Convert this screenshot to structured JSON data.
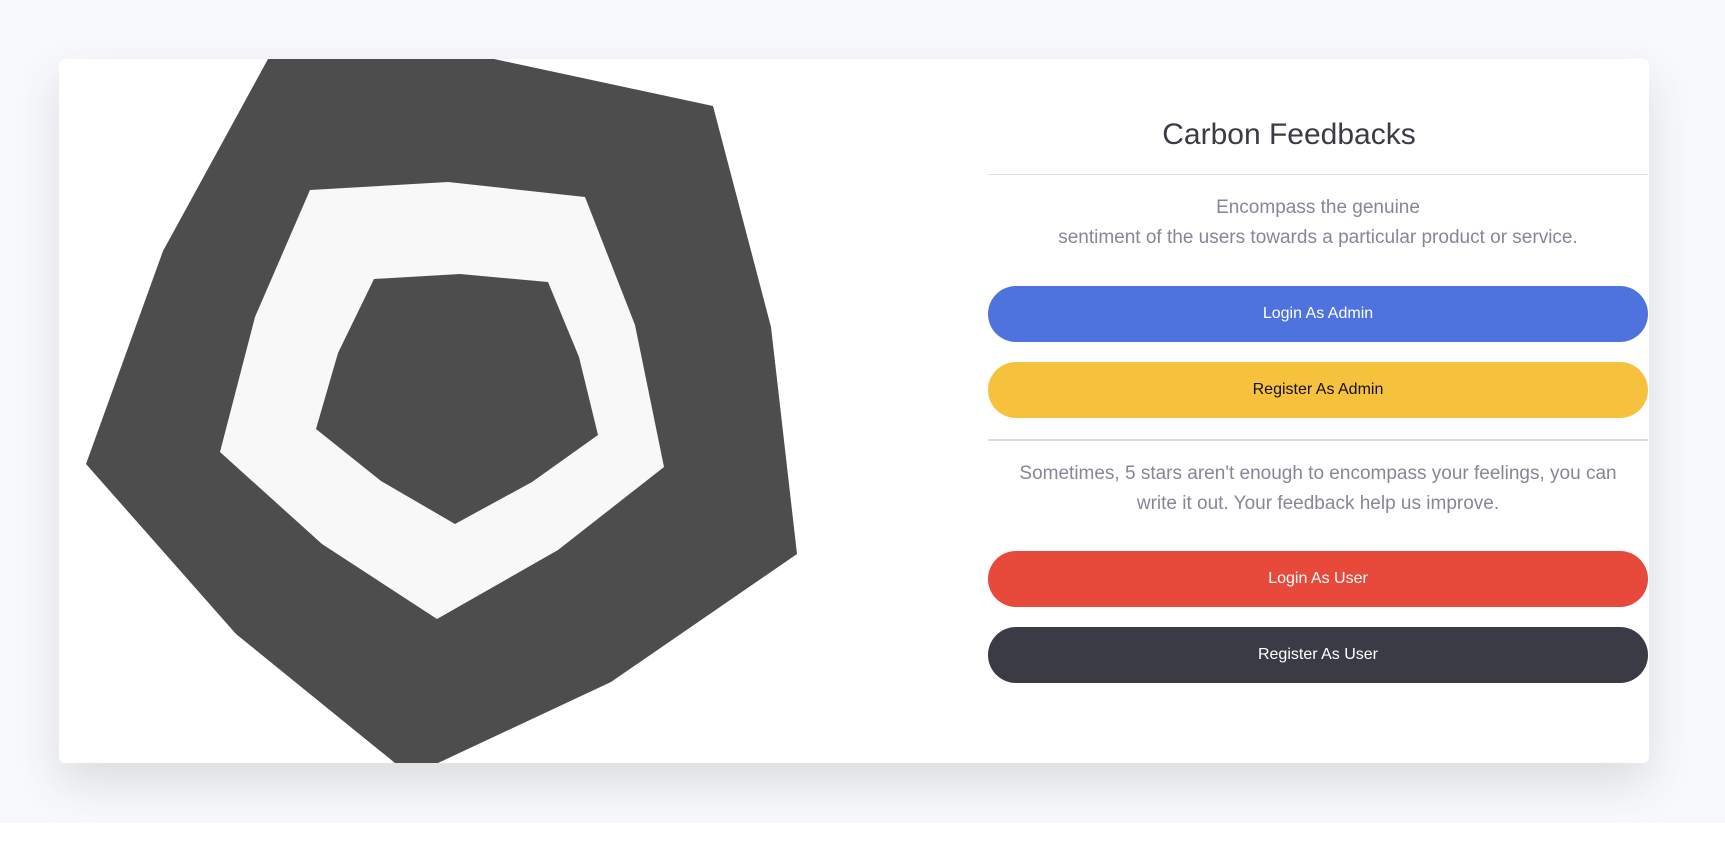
{
  "app": {
    "title": "Carbon Feedbacks"
  },
  "intro": {
    "line1": "Encompass the genuine",
    "line2": "sentiment of the users towards a particular product or service."
  },
  "admin": {
    "login_label": "Login As Admin",
    "register_label": "Register As Admin"
  },
  "user_section": {
    "line1": "Sometimes, 5 stars aren't enough to encompass your feelings, you can",
    "line2": "write it out. Your feedback help us improve.",
    "login_label": "Login As User",
    "register_label": "Register As User"
  },
  "colors": {
    "primary": "#4e73df",
    "warning": "#f6c23e",
    "danger": "#e74a3b",
    "dark": "#3a3b45",
    "shape": "#4d4d4d"
  }
}
